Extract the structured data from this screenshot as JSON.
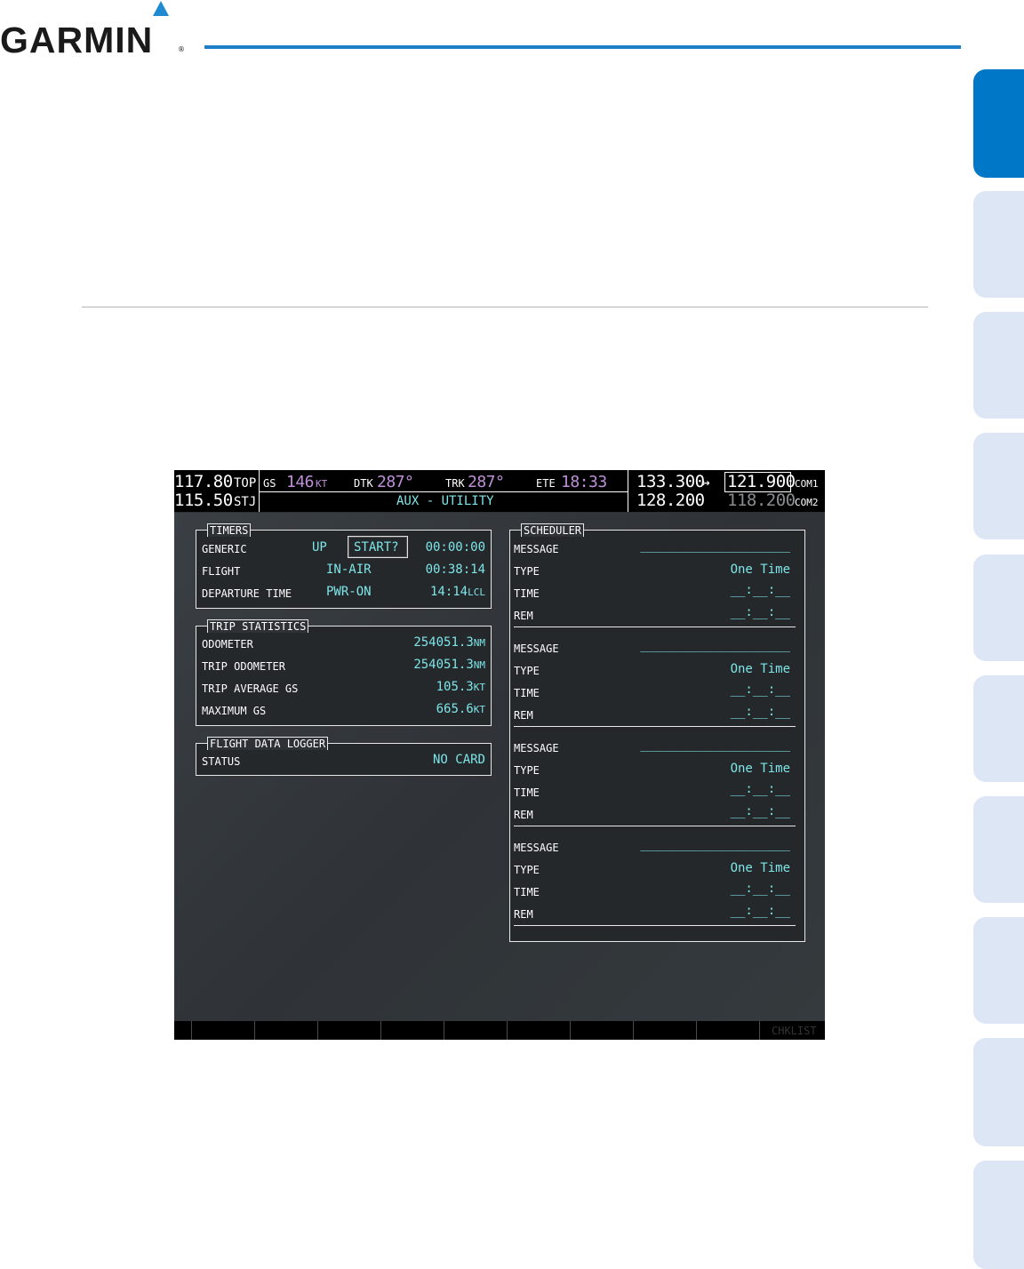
{
  "brand": {
    "logo_text": "GARMIN",
    "registered_mark": "®"
  },
  "status_bar": {
    "nav1": {
      "freq": "117.80",
      "ident": "TOP"
    },
    "nav2": {
      "freq": "115.50",
      "ident": "STJ"
    },
    "gs": {
      "label": "GS",
      "value": "146",
      "unit": "KT"
    },
    "dtk": {
      "label": "DTK",
      "value": "287°"
    },
    "trk": {
      "label": "TRK",
      "value": "287°"
    },
    "ete": {
      "label": "ETE",
      "value": "18:33"
    },
    "page_title": "AUX - UTILITY",
    "com1": {
      "standby": "133.300",
      "swap_arrow": "↔",
      "active": "121.900",
      "label": "COM1"
    },
    "com2": {
      "standby": "128.200",
      "active": "118.200",
      "label": "COM2"
    }
  },
  "timers": {
    "title": "TIMERS",
    "generic": {
      "label": "GENERIC",
      "direction": "UP",
      "action": "START?",
      "value": "00:00:00"
    },
    "flight": {
      "label": "FLIGHT",
      "mode": "IN-AIR",
      "value": "00:38:14"
    },
    "departure": {
      "label": "DEPARTURE TIME",
      "mode": "PWR-ON",
      "value": "14:14",
      "unit": "LCL"
    }
  },
  "trip_statistics": {
    "title": "TRIP STATISTICS",
    "rows": [
      {
        "label": "ODOMETER",
        "value": "254051.3",
        "unit": "NM"
      },
      {
        "label": "TRIP ODOMETER",
        "value": "254051.3",
        "unit": "NM"
      },
      {
        "label": "TRIP AVERAGE GS",
        "value": "105.3",
        "unit": "KT"
      },
      {
        "label": "MAXIMUM GS",
        "value": "665.6",
        "unit": "KT"
      }
    ]
  },
  "flight_data_logger": {
    "title": "FLIGHT DATA LOGGER",
    "status_label": "STATUS",
    "status_value": "NO CARD"
  },
  "scheduler": {
    "title": "SCHEDULER",
    "entries": [
      {
        "message_label": "MESSAGE",
        "message_value": "____________________",
        "type_label": "TYPE",
        "type_value": "One Time",
        "time_label": "TIME",
        "time_value": "__:__:__",
        "rem_label": "REM",
        "rem_value": "__:__:__"
      },
      {
        "message_label": "MESSAGE",
        "message_value": "____________________",
        "type_label": "TYPE",
        "type_value": "One Time",
        "time_label": "TIME",
        "time_value": "__:__:__",
        "rem_label": "REM",
        "rem_value": "__:__:__"
      },
      {
        "message_label": "MESSAGE",
        "message_value": "____________________",
        "type_label": "TYPE",
        "type_value": "One Time",
        "time_label": "TIME",
        "time_value": "__:__:__",
        "rem_label": "REM",
        "rem_value": "__:__:__"
      },
      {
        "message_label": "MESSAGE",
        "message_value": "____________________",
        "type_label": "TYPE",
        "type_value": "One Time",
        "time_label": "TIME",
        "time_value": "__:__:__",
        "rem_label": "REM",
        "rem_value": "__:__:__"
      }
    ]
  },
  "softkeys": {
    "last_label": "CHKLIST"
  },
  "colors": {
    "accent_blue": "#0077c7",
    "tab_inactive": "#dde6f5",
    "cyan": "#7ee5e8",
    "magenta": "#c08fd9"
  }
}
